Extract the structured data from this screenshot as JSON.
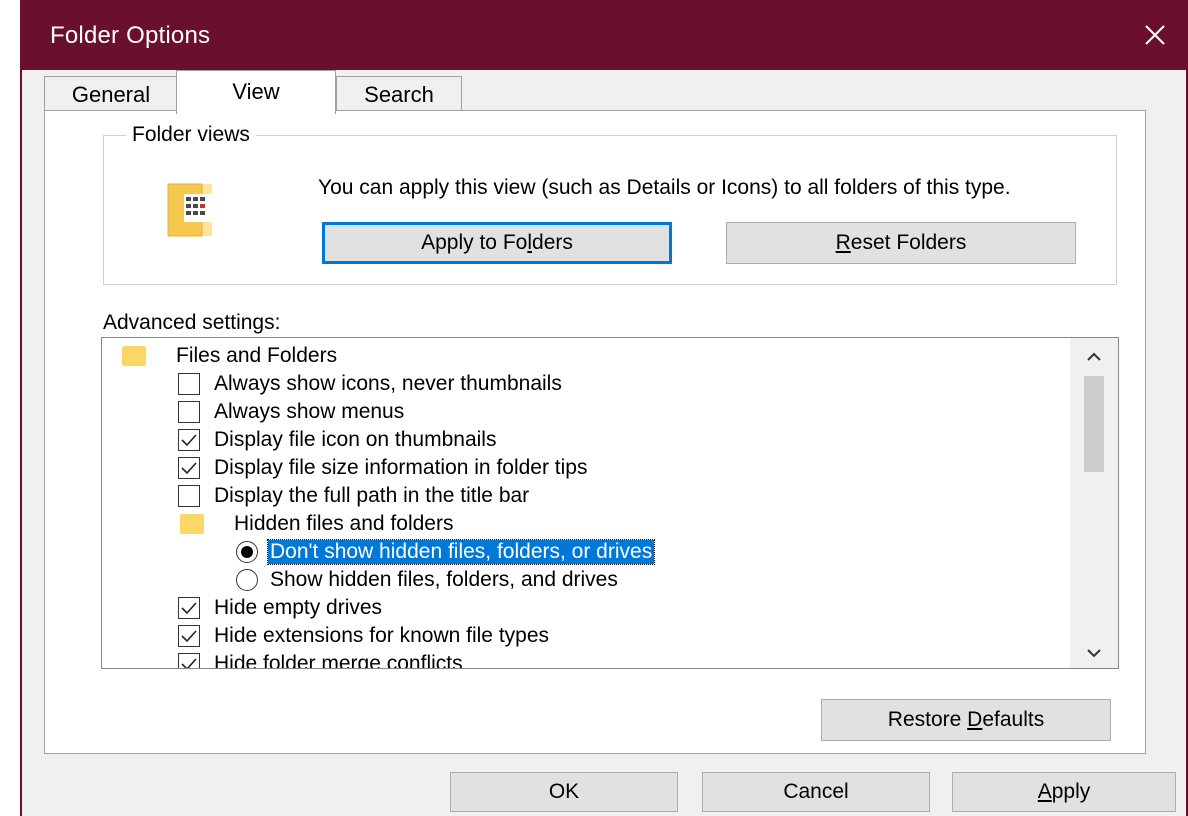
{
  "window": {
    "title": "Folder Options",
    "title_bar_color": "#6b0f2e"
  },
  "tabs": [
    {
      "label": "General",
      "active": false
    },
    {
      "label": "View",
      "active": true
    },
    {
      "label": "Search",
      "active": false
    }
  ],
  "folder_views": {
    "legend": "Folder views",
    "description": "You can apply this view (such as Details or Icons) to all folders of this type.",
    "apply_to_folders_pre": "Apply to Fo",
    "apply_to_folders_accel": "l",
    "apply_to_folders_post": "ders",
    "reset_folders_accel": "R",
    "reset_folders_post": "eset Folders"
  },
  "advanced": {
    "label": "Advanced settings:",
    "items": [
      {
        "type": "folder",
        "label": "Files and Folders"
      },
      {
        "type": "checkbox",
        "checked": false,
        "label": "Always show icons, never thumbnails"
      },
      {
        "type": "checkbox",
        "checked": false,
        "label": "Always show menus"
      },
      {
        "type": "checkbox",
        "checked": true,
        "label": "Display file icon on thumbnails"
      },
      {
        "type": "checkbox",
        "checked": true,
        "label": "Display file size information in folder tips"
      },
      {
        "type": "checkbox",
        "checked": false,
        "label": "Display the full path in the title bar"
      },
      {
        "type": "folder",
        "label": "Hidden files and folders"
      },
      {
        "type": "radio",
        "checked": true,
        "selected": true,
        "label": "Don't show hidden files, folders, or drives"
      },
      {
        "type": "radio",
        "checked": false,
        "label": "Show hidden files, folders, and drives"
      },
      {
        "type": "checkbox",
        "checked": true,
        "label": "Hide empty drives"
      },
      {
        "type": "checkbox",
        "checked": true,
        "label": "Hide extensions for known file types"
      },
      {
        "type": "checkbox",
        "checked": true,
        "label": "Hide folder merge conflicts"
      }
    ]
  },
  "restore_defaults": {
    "pre": "Restore ",
    "accel": "D",
    "post": "efaults"
  },
  "footer": {
    "ok": "OK",
    "cancel": "Cancel",
    "apply_accel": "A",
    "apply_post": "pply"
  },
  "colors": {
    "selection": "#0078d7",
    "folder": "#fcd666",
    "focus_border": "#0078d7"
  }
}
